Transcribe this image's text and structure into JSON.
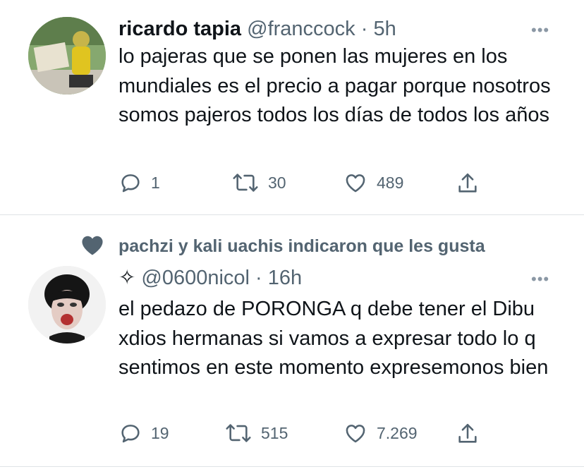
{
  "tweet1": {
    "name": "ricardo tapia",
    "handle": "@franccock",
    "separator": "·",
    "time": "5h",
    "more": "•••",
    "text": "lo pajeras que se ponen las mujeres en los mundiales es el precio a pagar porque nosotros somos pajeros todos los días de todos los años",
    "replies": "1",
    "retweets": "30",
    "likes": "489"
  },
  "tweet2": {
    "social_context": "pachzi y kali uachis indicaron que les gusta",
    "name_symbol": "✧",
    "handle": "@0600nicol",
    "separator": "·",
    "time": "16h",
    "more": "•••",
    "text": "el pedazo de PORONGA q debe tener el Dibu xdios hermanas si vamos a expresar todo lo q sentimos en este momento expresemonos bien",
    "replies": "19",
    "retweets": "515",
    "likes": "7.269"
  },
  "colors": {
    "text": "#0f1419",
    "secondary": "#536471",
    "divider": "#dfe3e6"
  }
}
